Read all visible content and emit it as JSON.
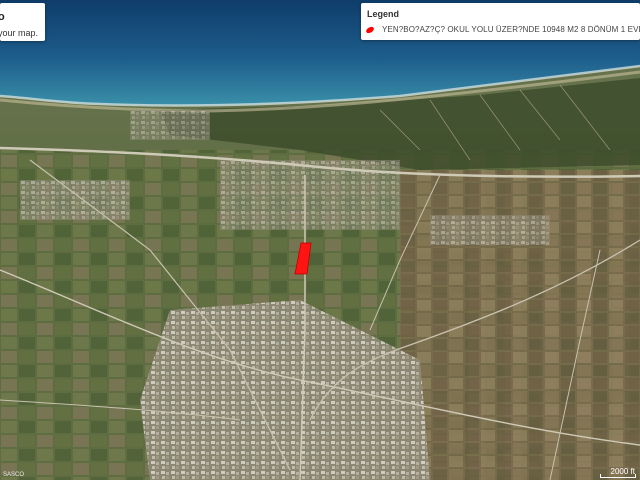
{
  "info_panel": {
    "title": "o",
    "subtitle": "your map."
  },
  "legend": {
    "title": "Legend",
    "entry_label": "YEN?BO?AZ?Ç? OKUL YOLU ÜZER?NDE 10948 M2 8 DÖNÜM 1 EVLEK Y",
    "marker_color": "#ff0000"
  },
  "map": {
    "parcel_color": "#ff1414",
    "sea_color": "#1f5a86",
    "land_color": "#5b6a3f"
  },
  "attribution": "SASCO",
  "scale": {
    "label": "2000 ft"
  }
}
